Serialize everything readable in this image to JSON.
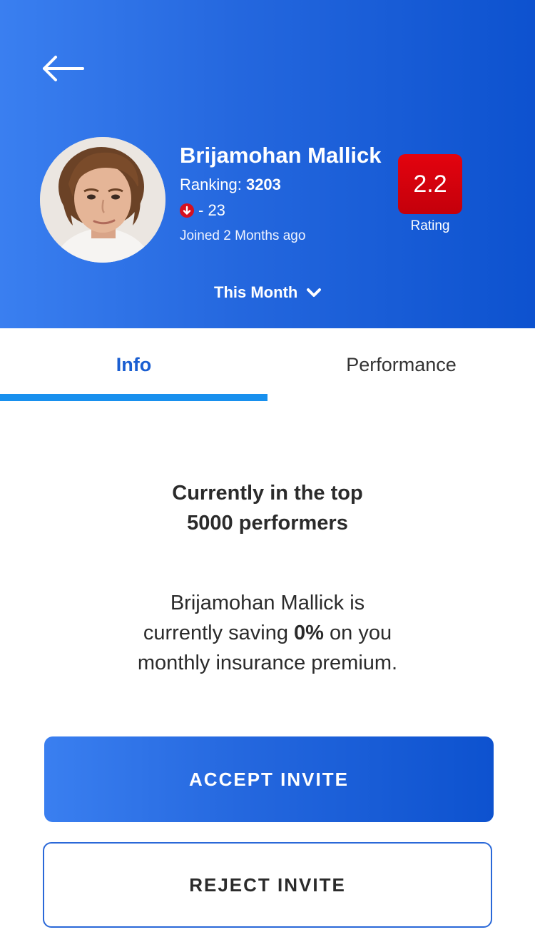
{
  "header": {
    "back_icon": "arrow-left-icon",
    "profile": {
      "name": "Brijamohan Mallick",
      "ranking_label": "Ranking: ",
      "ranking_value": "3203",
      "rank_change_icon": "down-arrow-circle-icon",
      "rank_change": "- 23",
      "joined": "Joined 2 Months ago"
    },
    "rating": {
      "value": "2.2",
      "label": "Rating",
      "color": "#d6000d"
    },
    "period": {
      "selected": "This Month",
      "icon": "chevron-down-icon"
    }
  },
  "tabs": [
    {
      "label": "Info",
      "active": true
    },
    {
      "label": "Performance",
      "active": false
    }
  ],
  "content": {
    "headline_line1": "Currently in the top",
    "headline_line2": "5000 performers",
    "description_line1": "Brijamohan Mallick is",
    "description_pre": "currently saving ",
    "description_value": "0%",
    "description_post": " on you",
    "description_line3": "monthly insurance premium."
  },
  "actions": {
    "accept_label": "ACCEPT INVITE",
    "reject_label": "REJECT INVITE"
  },
  "colors": {
    "brand_blue": "#1a5ed1",
    "tab_indicator": "#1890ee",
    "rating_red": "#d6000d",
    "rank_down_red": "#d6101f"
  }
}
